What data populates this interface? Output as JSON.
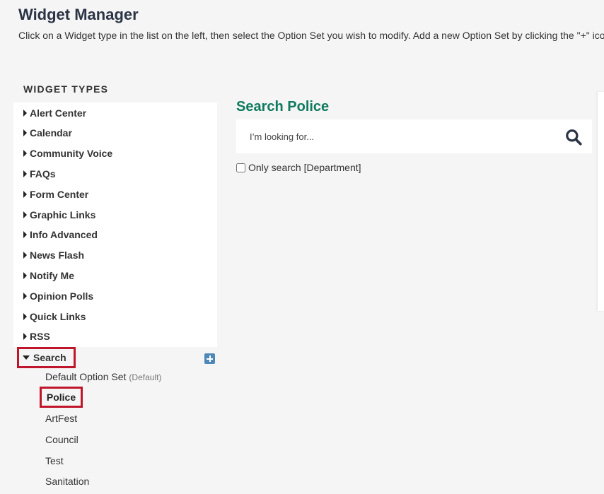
{
  "header": {
    "title": "Widget Manager",
    "description": "Click on a Widget type in the list on the left, then select the Option Set you wish to modify. Add a new Option Set by clicking the \"+\" icon."
  },
  "sidebar": {
    "heading": "WIDGET TYPES",
    "types": [
      {
        "label": "Alert Center"
      },
      {
        "label": "Calendar"
      },
      {
        "label": "Community Voice"
      },
      {
        "label": "FAQs"
      },
      {
        "label": "Form Center"
      },
      {
        "label": "Graphic Links"
      },
      {
        "label": "Info Advanced"
      },
      {
        "label": "News Flash"
      },
      {
        "label": "Notify Me"
      },
      {
        "label": "Opinion Polls"
      },
      {
        "label": "Quick Links"
      },
      {
        "label": "RSS"
      }
    ],
    "expanded_type": {
      "label": "Search",
      "add_icon": "plus-icon",
      "option_sets": [
        {
          "label": "Default Option Set",
          "tag": "(Default)"
        },
        {
          "label": "Police"
        },
        {
          "label": "ArtFest"
        },
        {
          "label": "Council"
        },
        {
          "label": "Test"
        },
        {
          "label": "Sanitation"
        }
      ]
    }
  },
  "preview": {
    "title": "Search Police",
    "search_placeholder": "I’m looking for...",
    "search_icon": "search-icon",
    "only_search_label": "Only search [Department]",
    "accent_color": "#0f7a5f",
    "highlight_color": "#c0162b"
  }
}
